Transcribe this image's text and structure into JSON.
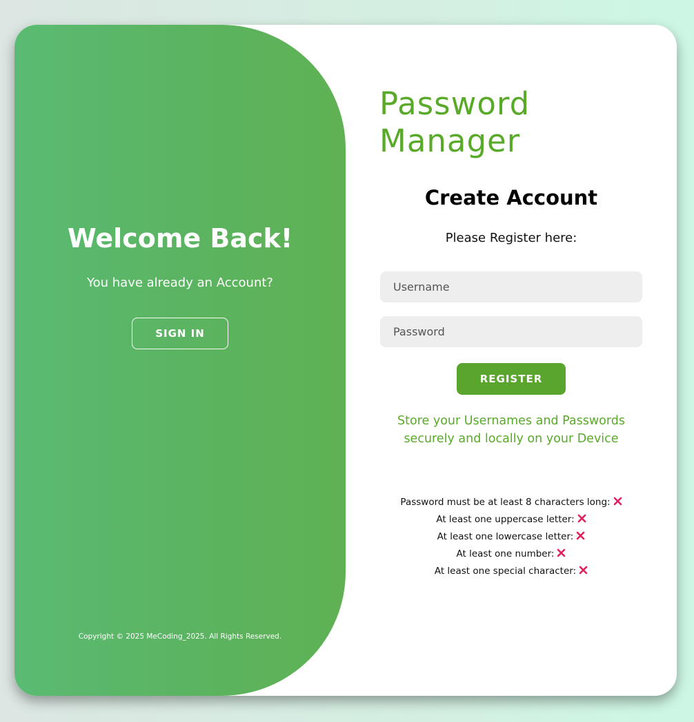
{
  "left_panel": {
    "title": "Welcome Back!",
    "subtitle": "You have already an Account?",
    "sign_in_label": "SIGN IN",
    "copyright": "Copyright © 2025 MeCoding_2025. All Rights Reserved."
  },
  "right_panel": {
    "app_title_line1": "Password",
    "app_title_line2": "Manager",
    "heading": "Create Account",
    "subheading": "Please Register here:",
    "username_placeholder": "Username",
    "password_placeholder": "Password",
    "register_label": "REGISTER",
    "tagline_line1": "Store your Usernames and Passwords",
    "tagline_line2": "securely and locally on your Device"
  },
  "password_rules": [
    {
      "text": "Password must be at least 8 characters long:",
      "status_icon": "cross-icon"
    },
    {
      "text": "At least one uppercase letter:",
      "status_icon": "cross-icon"
    },
    {
      "text": "At least one lowercase letter:",
      "status_icon": "cross-icon"
    },
    {
      "text": "At least one number:",
      "status_icon": "cross-icon"
    },
    {
      "text": "At least one special character:",
      "status_icon": "cross-icon"
    }
  ],
  "colors": {
    "accent_green": "#5aa52d",
    "panel_green": "#5bb462",
    "error_pink": "#e0205a"
  }
}
